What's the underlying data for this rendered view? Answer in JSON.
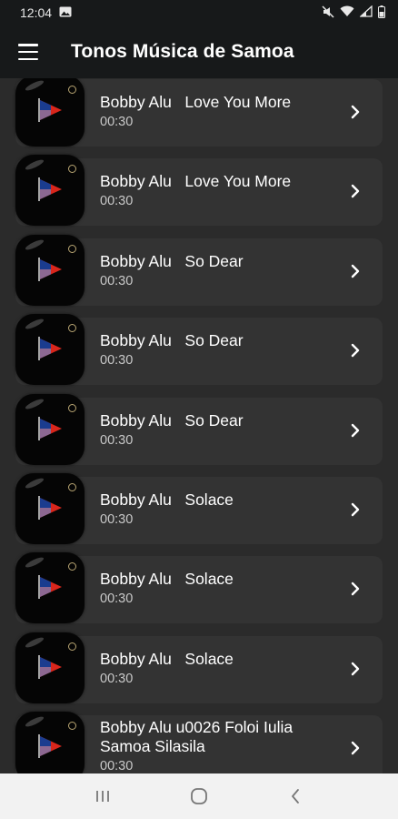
{
  "status_bar": {
    "time": "12:04",
    "icons": [
      "image-notification-icon",
      "mute-icon",
      "wifi-icon",
      "signal-icon",
      "battery-icon"
    ]
  },
  "app_bar": {
    "menu_icon": "hamburger-menu-icon",
    "title": "Tonos Música de Samoa"
  },
  "songs": [
    {
      "title": "Bobby Alu   Love You More",
      "duration": "00:30"
    },
    {
      "title": "Bobby Alu   Love You More",
      "duration": "00:30"
    },
    {
      "title": "Bobby Alu   So Dear",
      "duration": "00:30"
    },
    {
      "title": "Bobby Alu   So Dear",
      "duration": "00:30"
    },
    {
      "title": "Bobby Alu   So Dear",
      "duration": "00:30"
    },
    {
      "title": "Bobby Alu   Solace",
      "duration": "00:30"
    },
    {
      "title": "Bobby Alu   Solace",
      "duration": "00:30"
    },
    {
      "title": "Bobby Alu   Solace",
      "duration": "00:30"
    },
    {
      "title": "Bobby Alu u0026 Foloi Iulia\nSamoa Silasila",
      "duration": "00:30"
    }
  ],
  "row_icons": {
    "thumbnail": "samoa-flag-play-icon",
    "action": "chevron-right-icon"
  },
  "nav_bar": {
    "icons": [
      "recent-apps-icon",
      "home-icon",
      "back-icon"
    ]
  },
  "colors": {
    "background": "#2b2b2b",
    "card": "#333333",
    "app_bar": "#17191a",
    "nav_bar": "#f2f2f2"
  }
}
